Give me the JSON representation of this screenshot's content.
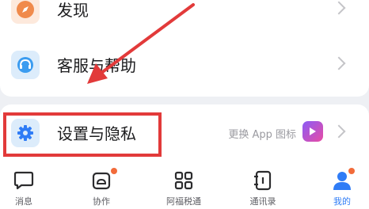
{
  "menu": {
    "discover": {
      "label": "发现",
      "icon": "compass-icon"
    },
    "support": {
      "label": "客服与帮助",
      "icon": "headset-icon"
    },
    "settings": {
      "label": "设置与隐私",
      "icon": "gear-icon",
      "hint": "更换 App 图标"
    }
  },
  "tabbar": {
    "items": [
      {
        "label": "消息",
        "icon": "message-icon"
      },
      {
        "label": "协作",
        "icon": "cloud-doc-icon",
        "badge": true
      },
      {
        "label": "阿福税通",
        "icon": "grid-apps-icon"
      },
      {
        "label": "通讯录",
        "icon": "contacts-book-icon"
      },
      {
        "label": "我的",
        "icon": "user-profile-icon",
        "active": true,
        "badge": true
      }
    ]
  },
  "colors": {
    "accent": "#2f7cf6",
    "annotation_red": "#e23a3a",
    "badge_orange": "#f26b3a"
  }
}
